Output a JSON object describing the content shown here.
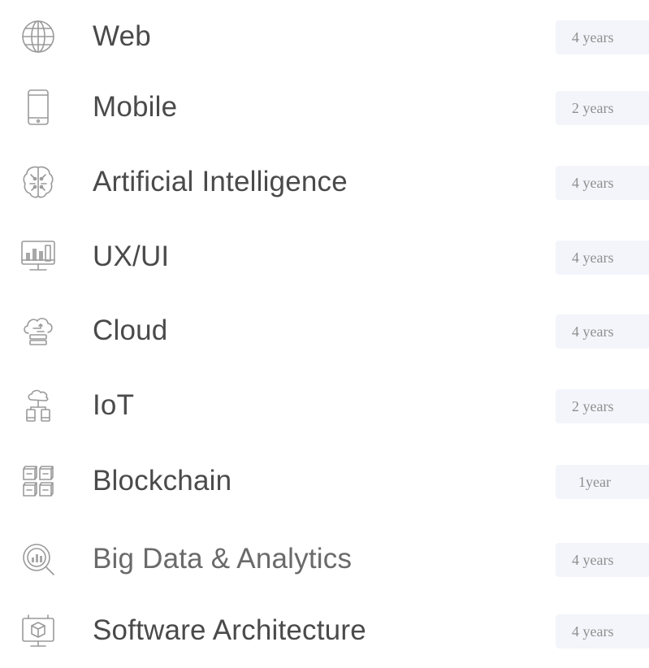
{
  "skills": [
    {
      "label": "Web",
      "duration": "4 years",
      "icon": "globe-icon"
    },
    {
      "label": "Mobile",
      "duration": "2 years",
      "icon": "smartphone-icon"
    },
    {
      "label": "Artificial Intelligence",
      "duration": "4 years",
      "icon": "brain-circuit-icon"
    },
    {
      "label": "UX/UI",
      "duration": "4 years",
      "icon": "monitor-design-icon"
    },
    {
      "label": "Cloud",
      "duration": "4 years",
      "icon": "cloud-server-icon"
    },
    {
      "label": "IoT",
      "duration": "2 years",
      "icon": "cloud-devices-icon"
    },
    {
      "label": "Blockchain",
      "duration": "1year",
      "icon": "blocks-icon"
    },
    {
      "label": "Big Data & Analytics",
      "duration": "4 years",
      "icon": "analytics-search-icon"
    },
    {
      "label": "Software Architecture",
      "duration": "4 years",
      "icon": "architecture-monitor-icon"
    }
  ],
  "colors": {
    "text": "#4a4a4a",
    "badge_bg": "#f3f5fa",
    "badge_text": "#8f8f8f",
    "icon": "#9a9a9a"
  }
}
